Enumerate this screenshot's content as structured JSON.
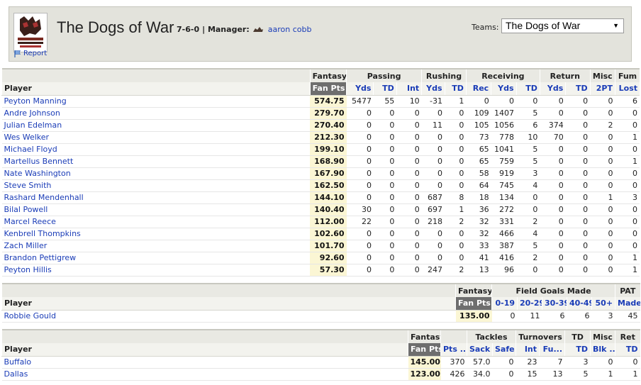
{
  "header": {
    "team_name": "The Dogs of War",
    "record": "7-6-0",
    "manager_label": "| Manager:",
    "manager_name": "aaron cobb",
    "report_label": "Report",
    "teams_label": "Teams:",
    "teams_selected": "The Dogs of War"
  },
  "offense": {
    "groups": [
      "Fantasy",
      "Passing",
      "Rushing",
      "Receiving",
      "Return",
      "Misc",
      "Fum"
    ],
    "player_header": "Player",
    "columns": [
      "Fan Pts",
      "Yds",
      "TD",
      "Int",
      "Yds",
      "TD",
      "Rec",
      "Yds",
      "TD",
      "Yds",
      "TD",
      "2PT",
      "Lost"
    ],
    "rows": [
      {
        "name": "Peyton Manning",
        "fan": "574.75",
        "vals": [
          "5477",
          "55",
          "10",
          "-31",
          "1",
          "0",
          "0",
          "0",
          "0",
          "0",
          "0",
          "6"
        ]
      },
      {
        "name": "Andre Johnson",
        "fan": "279.70",
        "vals": [
          "0",
          "0",
          "0",
          "0",
          "0",
          "109",
          "1407",
          "5",
          "0",
          "0",
          "0",
          "0"
        ]
      },
      {
        "name": "Julian Edelman",
        "fan": "270.40",
        "vals": [
          "0",
          "0",
          "0",
          "11",
          "0",
          "105",
          "1056",
          "6",
          "374",
          "0",
          "2",
          "0"
        ]
      },
      {
        "name": "Wes Welker",
        "fan": "212.30",
        "vals": [
          "0",
          "0",
          "0",
          "0",
          "0",
          "73",
          "778",
          "10",
          "70",
          "0",
          "0",
          "1"
        ]
      },
      {
        "name": "Michael Floyd",
        "fan": "199.10",
        "vals": [
          "0",
          "0",
          "0",
          "0",
          "0",
          "65",
          "1041",
          "5",
          "0",
          "0",
          "0",
          "0"
        ]
      },
      {
        "name": "Martellus Bennett",
        "fan": "168.90",
        "vals": [
          "0",
          "0",
          "0",
          "0",
          "0",
          "65",
          "759",
          "5",
          "0",
          "0",
          "0",
          "1"
        ]
      },
      {
        "name": "Nate Washington",
        "fan": "167.90",
        "vals": [
          "0",
          "0",
          "0",
          "0",
          "0",
          "58",
          "919",
          "3",
          "0",
          "0",
          "0",
          "0"
        ]
      },
      {
        "name": "Steve Smith",
        "fan": "162.50",
        "vals": [
          "0",
          "0",
          "0",
          "0",
          "0",
          "64",
          "745",
          "4",
          "0",
          "0",
          "0",
          "0"
        ]
      },
      {
        "name": "Rashard Mendenhall",
        "fan": "144.10",
        "vals": [
          "0",
          "0",
          "0",
          "687",
          "8",
          "18",
          "134",
          "0",
          "0",
          "0",
          "1",
          "3"
        ]
      },
      {
        "name": "Bilal Powell",
        "fan": "140.40",
        "vals": [
          "30",
          "0",
          "0",
          "697",
          "1",
          "36",
          "272",
          "0",
          "0",
          "0",
          "0",
          "0"
        ]
      },
      {
        "name": "Marcel Reece",
        "fan": "112.00",
        "vals": [
          "22",
          "0",
          "0",
          "218",
          "2",
          "32",
          "331",
          "2",
          "0",
          "0",
          "0",
          "0"
        ]
      },
      {
        "name": "Kenbrell Thompkins",
        "fan": "102.60",
        "vals": [
          "0",
          "0",
          "0",
          "0",
          "0",
          "32",
          "466",
          "4",
          "0",
          "0",
          "0",
          "0"
        ]
      },
      {
        "name": "Zach Miller",
        "fan": "101.70",
        "vals": [
          "0",
          "0",
          "0",
          "0",
          "0",
          "33",
          "387",
          "5",
          "0",
          "0",
          "0",
          "0"
        ]
      },
      {
        "name": "Brandon Pettigrew",
        "fan": "92.60",
        "vals": [
          "0",
          "0",
          "0",
          "0",
          "0",
          "41",
          "416",
          "2",
          "0",
          "0",
          "0",
          "1"
        ]
      },
      {
        "name": "Peyton Hillis",
        "fan": "57.30",
        "vals": [
          "0",
          "0",
          "0",
          "247",
          "2",
          "13",
          "96",
          "0",
          "0",
          "0",
          "0",
          "1"
        ]
      }
    ]
  },
  "kicker": {
    "groups": [
      "Fantasy",
      "Field Goals Made",
      "PAT"
    ],
    "player_header": "Player",
    "columns": [
      "Fan Pts",
      "0-19",
      "20-29",
      "30-39",
      "40-49",
      "50+",
      "Made"
    ],
    "rows": [
      {
        "name": "Robbie Gould",
        "fan": "135.00",
        "vals": [
          "0",
          "11",
          "6",
          "6",
          "3",
          "45"
        ]
      }
    ]
  },
  "defense": {
    "groups": [
      "Fantasy",
      "Tackles",
      "Turnovers",
      "TD",
      "Misc",
      "Ret"
    ],
    "player_header": "Player",
    "columns": [
      "Fan Pts",
      "Pts ...",
      "Sack",
      "Safe",
      "Int",
      "Fu...",
      "TD",
      "Blk ...",
      "TD"
    ],
    "rows": [
      {
        "name": "Buffalo",
        "fan": "145.00",
        "vals": [
          "370",
          "57.0",
          "0",
          "23",
          "7",
          "3",
          "0",
          "0"
        ]
      },
      {
        "name": "Dallas",
        "fan": "123.00",
        "vals": [
          "426",
          "34.0",
          "0",
          "15",
          "13",
          "5",
          "1",
          "1"
        ]
      }
    ]
  }
}
